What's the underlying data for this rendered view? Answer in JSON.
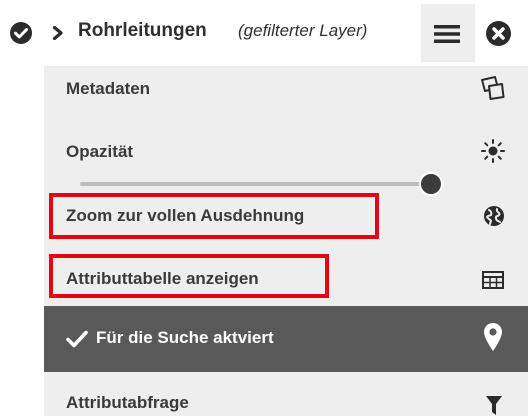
{
  "header": {
    "title": "Rohrleitungen",
    "subtitle": "(gefilterter Layer)",
    "icons": [
      "check-circle-icon",
      "chevron-right-icon",
      "hamburger-menu-icon",
      "close-circle-icon"
    ]
  },
  "menu": {
    "metadata_label": "Metadaten",
    "opacity_label": "Opazität",
    "opacity_value": 1.0,
    "zoom_label": "Zoom zur vollen Ausdehnung",
    "attribute_table_label": "Attributtabelle anzeigen",
    "search_label": "Für die Suche aktviert",
    "attribute_query_label": "Attributabfrage"
  },
  "colors": {
    "highlight": "#e30613",
    "panel": "#eeeeee",
    "active_row": "#595959",
    "text": "#3a3a3a"
  }
}
